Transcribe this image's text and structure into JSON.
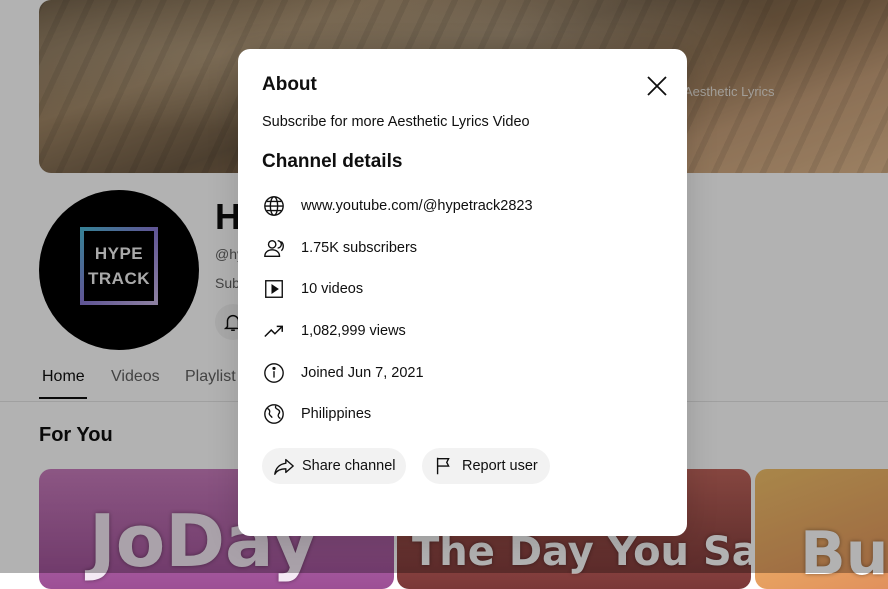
{
  "banner": {
    "text": "Aesthetic Lyrics"
  },
  "channel": {
    "logo_line1": "HYPE",
    "logo_line2": "TRACK",
    "title_partial": "H",
    "handle_partial": "@hy",
    "subscribe_partial": "Subs"
  },
  "tabs": [
    {
      "label": "Home",
      "active": true
    },
    {
      "label": "Videos",
      "active": false
    },
    {
      "label": "Playlist",
      "active": false
    }
  ],
  "section": {
    "title": "For You"
  },
  "thumbnails": [
    {
      "text": "JoDay",
      "color": "#b56aa8"
    },
    {
      "text": "The Day You Said",
      "color": "#a24d4d"
    },
    {
      "text": "Bu",
      "color": "#e8a84c"
    }
  ],
  "about": {
    "title": "About",
    "description": "Subscribe for more Aesthetic Lyrics Video",
    "details_title": "Channel details",
    "rows": [
      {
        "icon": "globe-icon",
        "text": "www.youtube.com/@hypetrack2823"
      },
      {
        "icon": "subscribers-icon",
        "text": "1.75K subscribers"
      },
      {
        "icon": "video-icon",
        "text": "10 videos"
      },
      {
        "icon": "trending-icon",
        "text": "1,082,999 views"
      },
      {
        "icon": "info-icon",
        "text": "Joined Jun 7, 2021"
      },
      {
        "icon": "world-icon",
        "text": "Philippines"
      }
    ],
    "share_label": "Share channel",
    "report_label": "Report user"
  }
}
